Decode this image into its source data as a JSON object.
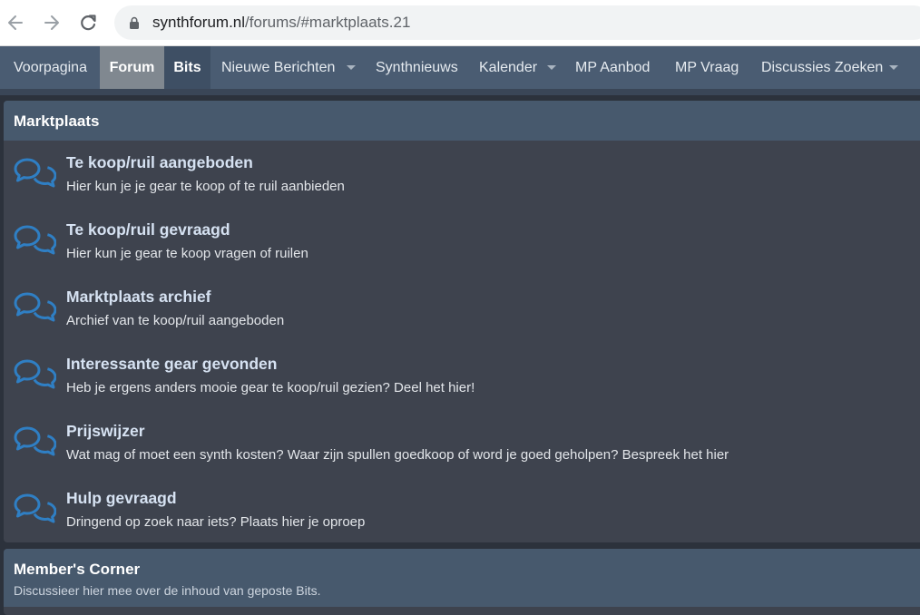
{
  "browser": {
    "url_host": "synthforum.nl",
    "url_path": "/forums/#marktplaats.21"
  },
  "nav": {
    "tabs": [
      {
        "label": "Voorpagina"
      },
      {
        "label": "Forum"
      },
      {
        "label": "Bits"
      },
      {
        "label": "Nieuwe Berichten"
      },
      {
        "label": "Synthnieuws"
      },
      {
        "label": "Kalender"
      },
      {
        "label": "MP Aanbod"
      },
      {
        "label": "MP Vraag"
      },
      {
        "label": "Discussies Zoeken"
      }
    ]
  },
  "category": {
    "title": "Marktplaats",
    "forums": [
      {
        "title": "Te koop/ruil aangeboden",
        "description": "Hier kun je je gear te koop of te ruil aanbieden"
      },
      {
        "title": "Te koop/ruil gevraagd",
        "description": "Hier kun je gear te koop vragen of ruilen"
      },
      {
        "title": "Marktplaats archief",
        "description": "Archief van te koop/ruil aangeboden"
      },
      {
        "title": "Interessante gear gevonden",
        "description": "Heb je ergens anders mooie gear te koop/ruil gezien? Deel het hier!"
      },
      {
        "title": "Prijswijzer",
        "description": "Wat mag of moet een synth kosten? Waar zijn spullen goedkoop of word je goed geholpen? Bespreek het hier"
      },
      {
        "title": "Hulp gevraagd",
        "description": "Dringend op zoek naar iets? Plaats hier je oproep"
      }
    ]
  },
  "member_corner": {
    "title": "Member's Corner",
    "description": "Discussieer hier mee over de inhoud van geposte Bits."
  },
  "colors": {
    "navbar": "#4a5c72",
    "node_title": "#d6e2f2",
    "icon": "#2f7fc4"
  }
}
